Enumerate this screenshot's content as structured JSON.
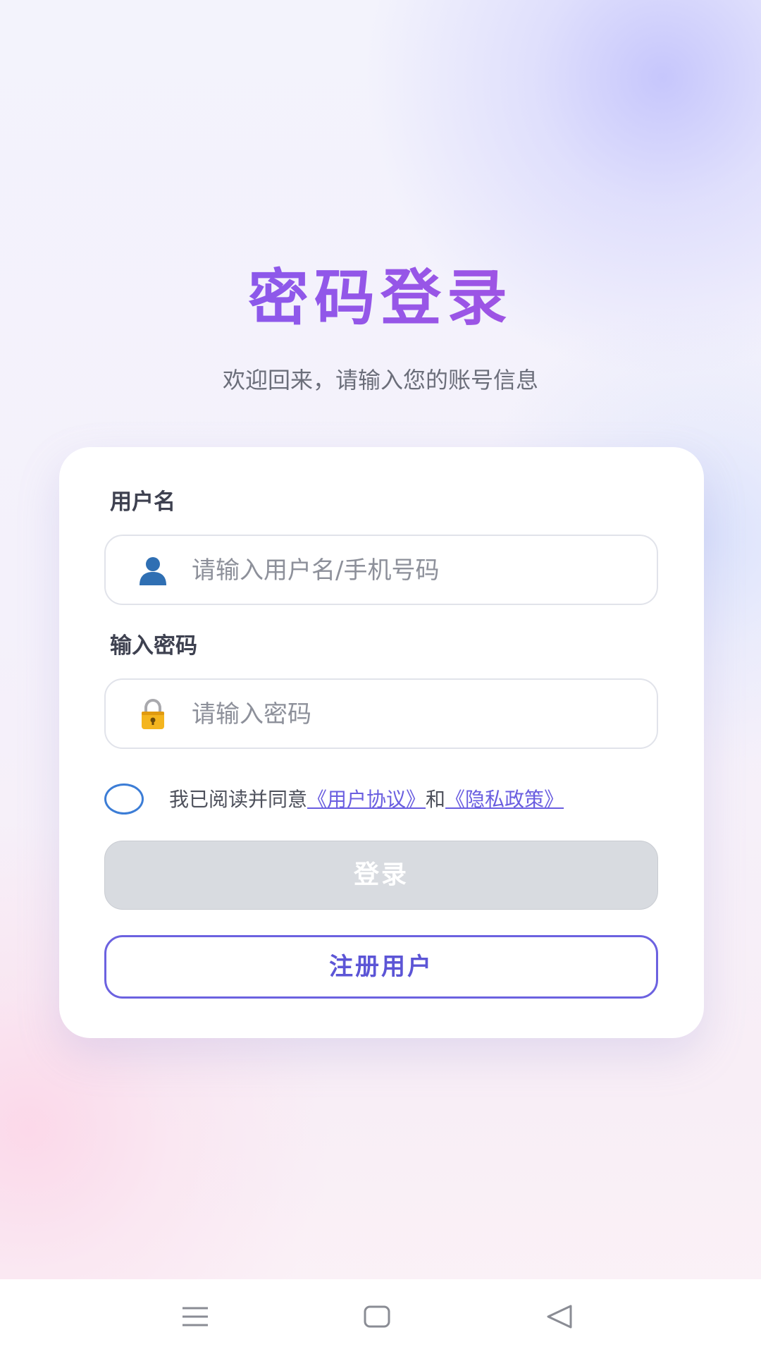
{
  "page": {
    "title": "密码登录",
    "subtitle": "欢迎回来，请输入您的账号信息"
  },
  "form": {
    "username": {
      "label": "用户名",
      "placeholder": "请输入用户名/手机号码",
      "value": "",
      "icon": "user-icon"
    },
    "password": {
      "label": "输入密码",
      "placeholder": "请输入密码",
      "value": "",
      "icon": "lock-icon"
    },
    "agreement": {
      "checked": false,
      "prefix": "我已阅读并同意",
      "user_agreement_link": "《用户协议》",
      "joiner": "和",
      "privacy_link": "《隐私政策》"
    },
    "login_label": "登录",
    "register_label": "注册用户"
  },
  "navbar": {
    "buttons": [
      "menu-icon",
      "home-icon",
      "back-icon"
    ]
  },
  "colors": {
    "title_gradient_start": "#7b5cf0",
    "title_gradient_end": "#b14fd9",
    "accent": "#6c62e0",
    "link": "#6a5ee0",
    "radio_border": "#3c7dd6",
    "login_disabled_bg": "#d8dbe0"
  }
}
